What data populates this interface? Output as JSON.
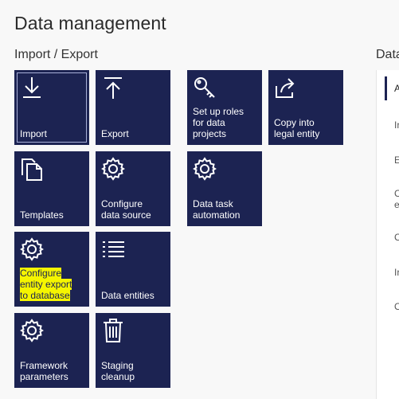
{
  "page": {
    "title": "Data management"
  },
  "section": {
    "title": "Import / Export"
  },
  "right_section": {
    "title": "Data"
  },
  "tiles": {
    "import": {
      "label": "Import",
      "icon": "download-icon"
    },
    "export": {
      "label": "Export",
      "icon": "upload-icon"
    },
    "roles": {
      "label": "Set up roles\nfor data\nprojects",
      "icon": "key-icon"
    },
    "copy": {
      "label": "Copy into\nlegal entity",
      "icon": "share-icon"
    },
    "templates": {
      "label": "Templates",
      "icon": "copy-icon"
    },
    "configure_source": {
      "label": "Configure\ndata source",
      "icon": "gear-icon"
    },
    "task_automation": {
      "label": "Data task\nautomation",
      "icon": "gear-icon"
    },
    "configure_export": {
      "label": "Configure\nentity export\nto database",
      "icon": "gear-icon"
    },
    "entities": {
      "label": "Data entities",
      "icon": "list-icon"
    },
    "framework": {
      "label": "Framework\nparameters",
      "icon": "gear-icon"
    },
    "staging": {
      "label": "Staging\ncleanup",
      "icon": "trash-icon"
    }
  },
  "right_panel": {
    "items": [
      "A",
      "Ir",
      "E:",
      "C",
      "e",
      "C",
      "Ir",
      "O"
    ]
  },
  "colors": {
    "tile_bg": "#1c2352",
    "highlight": "#f5f500"
  }
}
